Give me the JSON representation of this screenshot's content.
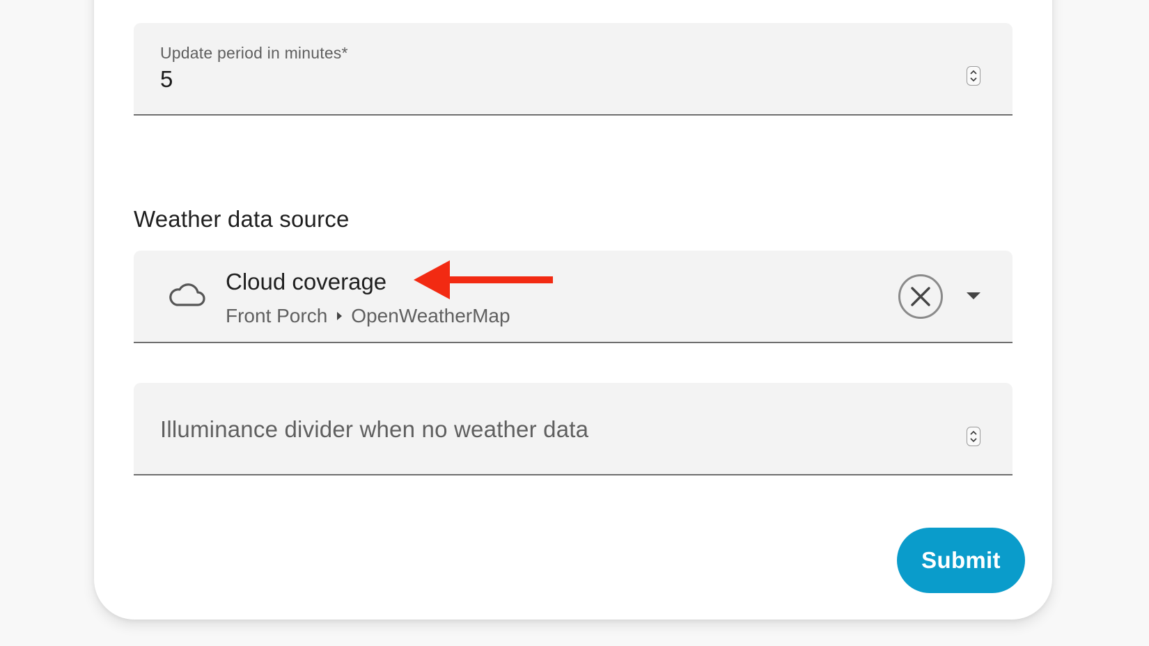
{
  "update_period": {
    "label": "Update period in minutes*",
    "value": "5"
  },
  "weather_section": {
    "title": "Weather data source"
  },
  "weather_source": {
    "icon": "cloud-icon",
    "entity_name": "Cloud coverage",
    "device": "Front Porch",
    "integration": "OpenWeatherMap"
  },
  "illuminance_divider": {
    "label": "Illuminance divider when no weather data"
  },
  "actions": {
    "submit_label": "Submit"
  },
  "colors": {
    "accent": "#0a9ccb",
    "annotation_arrow": "#f22a12",
    "field_bg": "#f3f3f3"
  }
}
